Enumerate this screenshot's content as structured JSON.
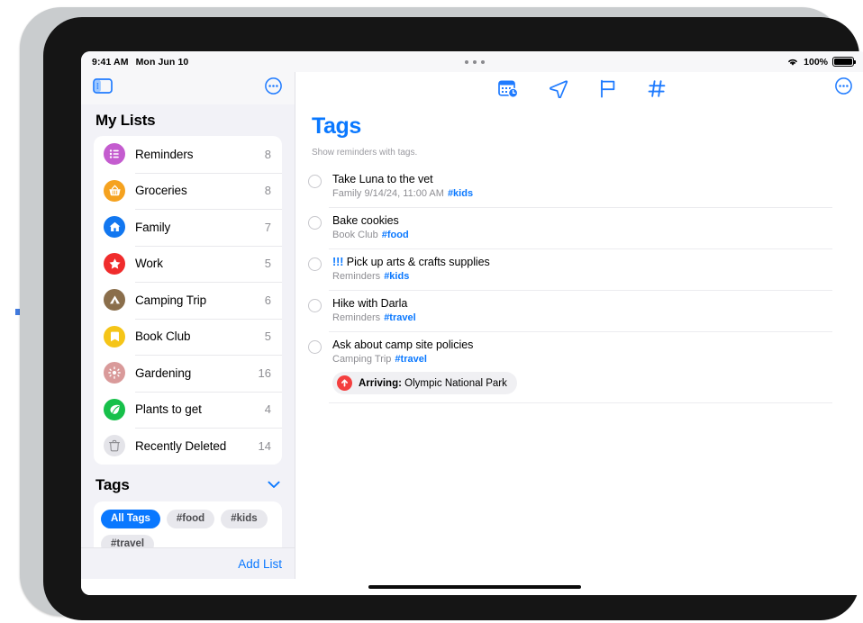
{
  "status_bar": {
    "time": "9:41 AM",
    "date": "Mon Jun 10",
    "battery_percent": "100%",
    "wifi_icon": "wifi-icon",
    "battery_icon": "battery-full-icon"
  },
  "sidebar": {
    "toggle_icon": "sidebar-toggle-icon",
    "more_icon": "more-circle-icon",
    "title": "My Lists",
    "lists": [
      {
        "label": "Reminders",
        "count": "8",
        "icon": "list-bullet-icon",
        "color": "#c45ccf"
      },
      {
        "label": "Groceries",
        "count": "8",
        "icon": "basket-icon",
        "color": "#f5a21f"
      },
      {
        "label": "Family",
        "count": "7",
        "icon": "house-icon",
        "color": "#1277f0"
      },
      {
        "label": "Work",
        "count": "5",
        "icon": "star-icon",
        "color": "#f02c2c"
      },
      {
        "label": "Camping Trip",
        "count": "6",
        "icon": "tent-icon",
        "color": "#8a6e4b"
      },
      {
        "label": "Book Club",
        "count": "5",
        "icon": "bookmark-icon",
        "color": "#f5c518"
      },
      {
        "label": "Gardening",
        "count": "16",
        "icon": "flower-icon",
        "color": "#d99a9a"
      },
      {
        "label": "Plants to get",
        "count": "4",
        "icon": "leaf-icon",
        "color": "#17c04a"
      },
      {
        "label": "Recently Deleted",
        "count": "14",
        "icon": "trash-icon",
        "color": "#e4e4e9"
      }
    ],
    "tags_section": {
      "title": "Tags",
      "chevron_icon": "chevron-down-icon",
      "tags": [
        {
          "label": "All Tags",
          "selected": true
        },
        {
          "label": "#food",
          "selected": false
        },
        {
          "label": "#kids",
          "selected": false
        },
        {
          "label": "#travel",
          "selected": false
        }
      ]
    },
    "add_list_label": "Add List"
  },
  "detail": {
    "toolbar_icons": [
      "calendar-clock-icon",
      "location-arrow-icon",
      "flag-icon",
      "hashtag-icon"
    ],
    "more_icon": "more-circle-icon",
    "title": "Tags",
    "subtitle": "Show reminders with tags.",
    "reminders": [
      {
        "priority": "",
        "title": "Take Luna to the vet",
        "list": "Family",
        "date": "9/14/24, 11:00 AM",
        "tag": "#kids",
        "location_chip": null
      },
      {
        "priority": "",
        "title": "Bake cookies",
        "list": "Book Club",
        "date": "",
        "tag": "#food",
        "location_chip": null
      },
      {
        "priority": "!!!",
        "title": "Pick up arts & crafts supplies",
        "list": "Reminders",
        "date": "",
        "tag": "#kids",
        "location_chip": null
      },
      {
        "priority": "",
        "title": "Hike with Darla",
        "list": "Reminders",
        "date": "",
        "tag": "#travel",
        "location_chip": null
      },
      {
        "priority": "",
        "title": "Ask about camp site policies",
        "list": "Camping Trip",
        "date": "",
        "tag": "#travel",
        "location_chip": {
          "icon": "arrow-up-circle-icon",
          "label": "Arriving:",
          "value": "Olympic National Park"
        }
      }
    ]
  },
  "colors": {
    "accent_blue": "#0a78ff",
    "sidebar_bg": "#f2f2f7",
    "alert_red": "#f43f3f"
  }
}
